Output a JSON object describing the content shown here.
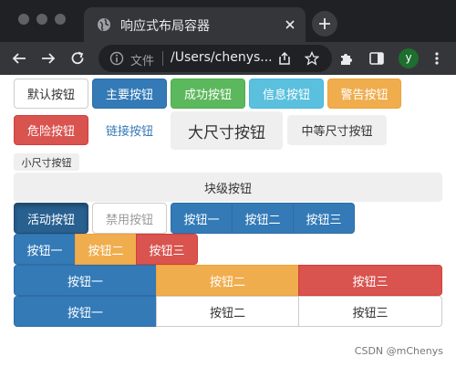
{
  "window": {
    "tab_title": "响应式布局容器",
    "address_scheme": "文件",
    "address_url": "/Users/chenys...",
    "profile_initial": "y"
  },
  "row1": {
    "default": "默认按钮",
    "primary": "主要按钮",
    "success": "成功按钮",
    "info": "信息按钮",
    "warning": "警告按钮"
  },
  "row2": {
    "danger": "危险按钮",
    "link": "链接按钮",
    "large": "大尺寸按钮",
    "medium": "中等尺寸按钮"
  },
  "row3": {
    "small": "小尺寸按钮"
  },
  "row4": {
    "block": "块级按钮"
  },
  "row5": {
    "active": "活动按钮",
    "disabled": "禁用按钮",
    "group": [
      "按钮一",
      "按钮二",
      "按钮三"
    ]
  },
  "row6": {
    "group": [
      "按钮一",
      "按钮二",
      "按钮三"
    ]
  },
  "row7": {
    "group": [
      "按钮一",
      "按钮二",
      "按钮三"
    ]
  },
  "row8": {
    "group": [
      "按钮一",
      "按钮二",
      "按钮三"
    ]
  },
  "watermark": "CSDN @mChenys",
  "colors": {
    "primary": "#337ab7",
    "success": "#5cb85c",
    "info": "#5bc0de",
    "warning": "#f0ad4e",
    "danger": "#d9534f"
  }
}
